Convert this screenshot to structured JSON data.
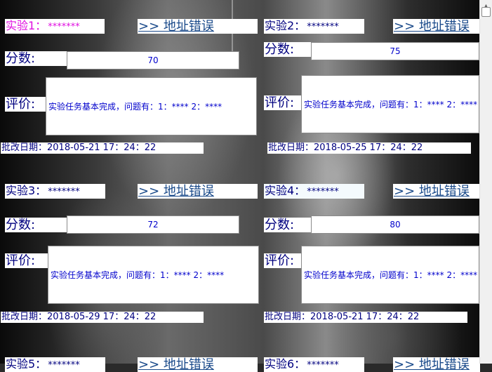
{
  "experiments": [
    {
      "title": "实验1：",
      "title_value": "*******",
      "link": ">> 地址错误",
      "score_label": "分数:",
      "score": "70",
      "comment_label": "评价:",
      "comment": "实验任务基本完成，问题有：1：**** 2：****",
      "date": "批改日期：2018-05-21 17：24：22"
    },
    {
      "title": "实验2：",
      "title_value": "*******",
      "link": ">> 地址错误",
      "score_label": "分数:",
      "score": "75",
      "comment_label": "评价:",
      "comment": "实验任务基本完成，问题有：1：**** 2：****",
      "date": "批改日期：2018-05-25 17：24：22"
    },
    {
      "title": "实验3：",
      "title_value": "*******",
      "link": ">> 地址错误",
      "score_label": "分数:",
      "score": "72",
      "comment_label": "评价:",
      "comment": "实验任务基本完成，问题有：1：**** 2：****",
      "date": "批改日期：2018-05-29 17：24：22"
    },
    {
      "title": "实验4：",
      "title_value": "*******",
      "link": ">> 地址错误",
      "score_label": "分数:",
      "score": "80",
      "comment_label": "评价:",
      "comment": "实验任务基本完成，问题有：1：**** 2：****",
      "date": "批改日期：2018-05-21 17：24：22"
    },
    {
      "title": "实验5：",
      "title_value": "*******",
      "link": ">> 地址错误"
    },
    {
      "title": "实验6：",
      "title_value": "*******",
      "link": ">> 地址错误"
    }
  ],
  "colors": {
    "active_title": "#e010e0",
    "text": "#00007f",
    "link": "#1a4a8a",
    "value": "#0000cc"
  },
  "icons": {
    "scroll_up": "triangle-up"
  }
}
